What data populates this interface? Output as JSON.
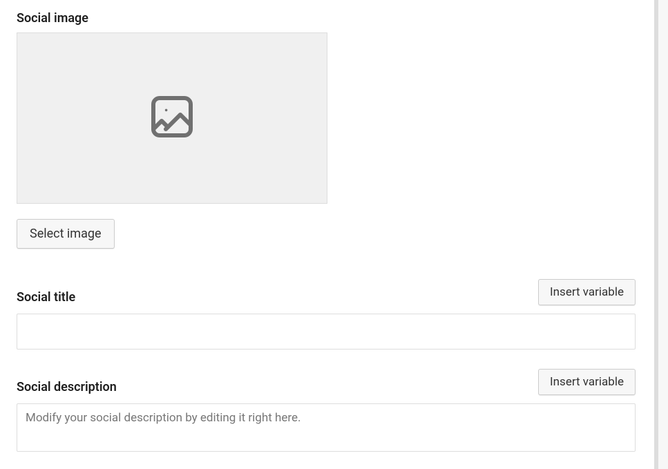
{
  "social_image": {
    "label": "Social image",
    "select_button": "Select image"
  },
  "social_title": {
    "label": "Social title",
    "insert_button": "Insert variable",
    "value": "",
    "placeholder": ""
  },
  "social_description": {
    "label": "Social description",
    "insert_button": "Insert variable",
    "value": "",
    "placeholder": "Modify your social description by editing it right here."
  }
}
